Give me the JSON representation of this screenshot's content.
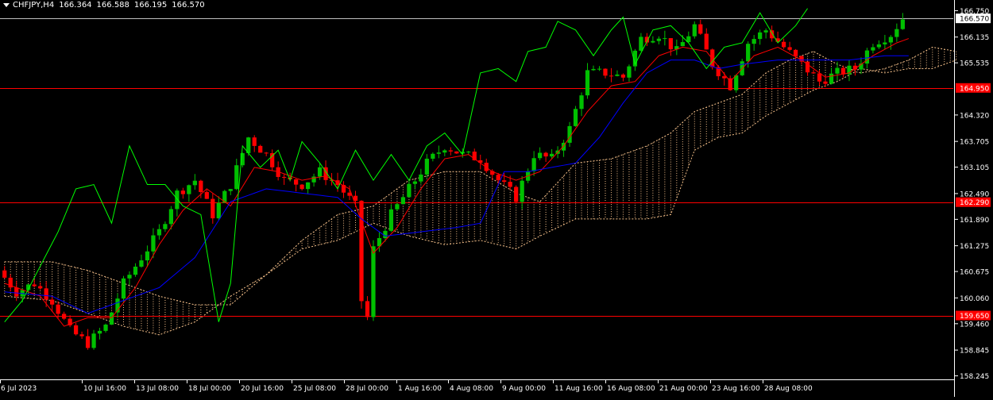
{
  "chart_data": {
    "type": "candlestick",
    "symbol": "CHFJPY,H4",
    "ohlc_label": {
      "open": "166.364",
      "high": "166.588",
      "low": "166.195",
      "close": "166.570"
    },
    "y_ticks": [
      "166.750",
      "166.570",
      "166.135",
      "165.535",
      "164.950",
      "164.320",
      "163.705",
      "163.105",
      "162.490",
      "162.290",
      "161.890",
      "161.275",
      "160.675",
      "160.060",
      "159.650",
      "159.460",
      "158.845",
      "158.245"
    ],
    "x_labels": [
      "6 Jul 2023",
      "10 Jul 16:00",
      "13 Jul 08:00",
      "18 Jul 00:00",
      "20 Jul 16:00",
      "25 Jul 08:00",
      "28 Jul 00:00",
      "1 Aug 16:00",
      "4 Aug 08:00",
      "9 Aug 00:00",
      "11 Aug 16:00",
      "16 Aug 08:00",
      "21 Aug 00:00",
      "23 Aug 16:00",
      "28 Aug 08:00"
    ],
    "ylim": [
      158.2,
      166.85
    ],
    "price_levels": [
      {
        "value": 166.57,
        "label": "166.570",
        "kind": "current"
      },
      {
        "value": 164.95,
        "label": "164.950",
        "kind": "horizontal"
      },
      {
        "value": 162.29,
        "label": "162.290",
        "kind": "horizontal"
      },
      {
        "value": 159.65,
        "label": "159.650",
        "kind": "horizontal"
      }
    ],
    "close_path": [
      [
        0,
        160.7
      ],
      [
        3,
        160.2
      ],
      [
        6,
        160.4
      ],
      [
        9,
        160.0
      ],
      [
        12,
        159.3
      ],
      [
        15,
        159.0
      ],
      [
        18,
        159.4
      ],
      [
        21,
        160.4
      ],
      [
        24,
        161.0
      ],
      [
        27,
        161.6
      ],
      [
        30,
        162.5
      ],
      [
        33,
        162.8
      ],
      [
        36,
        162.0
      ],
      [
        39,
        162.7
      ],
      [
        42,
        163.8
      ],
      [
        45,
        163.4
      ],
      [
        48,
        162.8
      ],
      [
        51,
        162.7
      ],
      [
        54,
        163.0
      ],
      [
        57,
        162.7
      ],
      [
        60,
        162.2
      ],
      [
        61,
        160.0
      ],
      [
        62,
        159.6
      ],
      [
        63,
        161.2
      ],
      [
        66,
        162.0
      ],
      [
        69,
        162.6
      ],
      [
        72,
        163.2
      ],
      [
        75,
        163.6
      ],
      [
        78,
        163.4
      ],
      [
        81,
        163.3
      ],
      [
        84,
        162.8
      ],
      [
        87,
        162.4
      ],
      [
        90,
        163.4
      ],
      [
        93,
        163.3
      ],
      [
        96,
        164.0
      ],
      [
        99,
        165.3
      ],
      [
        102,
        165.3
      ],
      [
        105,
        165.2
      ],
      [
        108,
        166.1
      ],
      [
        111,
        166.2
      ],
      [
        114,
        165.8
      ],
      [
        117,
        166.4
      ],
      [
        120,
        165.5
      ],
      [
        123,
        165.0
      ],
      [
        126,
        166.0
      ],
      [
        129,
        166.3
      ],
      [
        132,
        165.9
      ],
      [
        135,
        165.5
      ],
      [
        138,
        165.1
      ],
      [
        141,
        165.3
      ],
      [
        144,
        165.4
      ],
      [
        147,
        166.0
      ],
      [
        150,
        166.2
      ],
      [
        152,
        166.57
      ]
    ],
    "tenkan_path": [
      [
        0,
        160.4
      ],
      [
        6,
        160.1
      ],
      [
        10,
        159.4
      ],
      [
        14,
        159.6
      ],
      [
        18,
        159.6
      ],
      [
        22,
        160.3
      ],
      [
        26,
        161.3
      ],
      [
        30,
        162.1
      ],
      [
        34,
        162.6
      ],
      [
        38,
        162.2
      ],
      [
        42,
        163.1
      ],
      [
        46,
        163.0
      ],
      [
        50,
        162.8
      ],
      [
        54,
        162.9
      ],
      [
        58,
        162.6
      ],
      [
        62,
        161.1
      ],
      [
        66,
        161.7
      ],
      [
        70,
        162.6
      ],
      [
        74,
        163.3
      ],
      [
        78,
        163.4
      ],
      [
        82,
        163.0
      ],
      [
        86,
        162.8
      ],
      [
        90,
        163.0
      ],
      [
        94,
        163.6
      ],
      [
        98,
        164.4
      ],
      [
        102,
        165.0
      ],
      [
        106,
        165.1
      ],
      [
        110,
        165.7
      ],
      [
        114,
        165.9
      ],
      [
        118,
        165.8
      ],
      [
        122,
        165.1
      ],
      [
        126,
        165.7
      ],
      [
        130,
        165.9
      ],
      [
        134,
        165.6
      ],
      [
        138,
        165.2
      ],
      [
        142,
        165.3
      ],
      [
        146,
        165.7
      ],
      [
        150,
        166.0
      ],
      [
        152,
        166.1
      ]
    ],
    "kijun_path": [
      [
        0,
        160.2
      ],
      [
        8,
        160.1
      ],
      [
        14,
        159.7
      ],
      [
        20,
        160.0
      ],
      [
        26,
        160.3
      ],
      [
        32,
        161.0
      ],
      [
        38,
        162.3
      ],
      [
        44,
        162.6
      ],
      [
        50,
        162.5
      ],
      [
        56,
        162.4
      ],
      [
        60,
        161.9
      ],
      [
        64,
        161.5
      ],
      [
        70,
        161.6
      ],
      [
        76,
        161.7
      ],
      [
        80,
        161.8
      ],
      [
        84,
        163.0
      ],
      [
        88,
        163.0
      ],
      [
        92,
        163.1
      ],
      [
        96,
        163.2
      ],
      [
        100,
        163.8
      ],
      [
        104,
        164.6
      ],
      [
        108,
        165.3
      ],
      [
        112,
        165.6
      ],
      [
        116,
        165.6
      ],
      [
        120,
        165.4
      ],
      [
        124,
        165.5
      ],
      [
        130,
        165.6
      ],
      [
        136,
        165.6
      ],
      [
        142,
        165.6
      ],
      [
        148,
        165.7
      ],
      [
        152,
        165.7
      ]
    ],
    "chikou_path": [
      [
        0,
        159.5
      ],
      [
        3,
        160.0
      ],
      [
        6,
        160.8
      ],
      [
        9,
        161.6
      ],
      [
        12,
        162.6
      ],
      [
        15,
        162.7
      ],
      [
        18,
        161.8
      ],
      [
        21,
        163.6
      ],
      [
        24,
        162.7
      ],
      [
        27,
        162.7
      ],
      [
        30,
        162.2
      ],
      [
        33,
        162.0
      ],
      [
        36,
        159.5
      ],
      [
        38,
        160.4
      ],
      [
        40,
        163.6
      ],
      [
        43,
        163.1
      ],
      [
        46,
        163.5
      ],
      [
        48,
        162.8
      ],
      [
        50,
        163.7
      ],
      [
        53,
        163.2
      ],
      [
        56,
        162.6
      ],
      [
        59,
        163.5
      ],
      [
        62,
        162.8
      ],
      [
        65,
        163.4
      ],
      [
        68,
        162.8
      ],
      [
        71,
        163.6
      ],
      [
        74,
        163.9
      ],
      [
        77,
        163.4
      ],
      [
        80,
        165.3
      ],
      [
        83,
        165.4
      ],
      [
        86,
        165.1
      ],
      [
        88,
        165.8
      ],
      [
        91,
        165.9
      ],
      [
        93,
        166.5
      ],
      [
        96,
        166.3
      ],
      [
        99,
        165.7
      ],
      [
        102,
        166.3
      ],
      [
        104,
        166.6
      ],
      [
        106,
        165.5
      ],
      [
        109,
        166.3
      ],
      [
        112,
        166.4
      ],
      [
        115,
        166.0
      ],
      [
        118,
        165.4
      ],
      [
        121,
        165.9
      ],
      [
        124,
        166.0
      ],
      [
        127,
        166.7
      ],
      [
        130,
        166.0
      ],
      [
        133,
        166.4
      ],
      [
        135,
        166.8
      ]
    ],
    "kumo_top": [
      [
        0,
        160.9
      ],
      [
        8,
        160.9
      ],
      [
        14,
        160.7
      ],
      [
        20,
        160.4
      ],
      [
        26,
        160.1
      ],
      [
        32,
        159.9
      ],
      [
        38,
        159.9
      ],
      [
        44,
        160.6
      ],
      [
        50,
        161.4
      ],
      [
        56,
        162.0
      ],
      [
        62,
        162.2
      ],
      [
        68,
        162.8
      ],
      [
        74,
        163.0
      ],
      [
        80,
        163.0
      ],
      [
        86,
        162.5
      ],
      [
        90,
        162.3
      ],
      [
        96,
        163.2
      ],
      [
        102,
        163.3
      ],
      [
        108,
        163.6
      ],
      [
        112,
        163.9
      ],
      [
        116,
        164.4
      ],
      [
        120,
        164.6
      ],
      [
        124,
        164.8
      ],
      [
        128,
        165.3
      ],
      [
        132,
        165.6
      ],
      [
        136,
        165.8
      ],
      [
        140,
        165.5
      ],
      [
        144,
        165.3
      ],
      [
        148,
        165.4
      ],
      [
        152,
        165.6
      ],
      [
        156,
        165.9
      ],
      [
        160,
        165.8
      ]
    ],
    "kumo_bottom": [
      [
        0,
        160.1
      ],
      [
        8,
        160.0
      ],
      [
        14,
        159.7
      ],
      [
        20,
        159.4
      ],
      [
        26,
        159.2
      ],
      [
        32,
        159.5
      ],
      [
        38,
        160.1
      ],
      [
        44,
        160.6
      ],
      [
        50,
        161.2
      ],
      [
        56,
        161.4
      ],
      [
        62,
        161.8
      ],
      [
        68,
        161.5
      ],
      [
        74,
        161.3
      ],
      [
        80,
        161.4
      ],
      [
        86,
        161.2
      ],
      [
        90,
        161.5
      ],
      [
        96,
        161.9
      ],
      [
        102,
        161.9
      ],
      [
        108,
        161.9
      ],
      [
        112,
        162.0
      ],
      [
        116,
        163.5
      ],
      [
        120,
        163.8
      ],
      [
        124,
        163.9
      ],
      [
        128,
        164.3
      ],
      [
        132,
        164.6
      ],
      [
        136,
        164.9
      ],
      [
        140,
        165.1
      ],
      [
        144,
        165.4
      ],
      [
        148,
        165.3
      ],
      [
        152,
        165.4
      ],
      [
        156,
        165.4
      ],
      [
        160,
        165.6
      ]
    ],
    "n_bars": 152,
    "future_bars": 8,
    "colors": {
      "background": "#000000",
      "bull": "#00c000",
      "bear": "#ff0000",
      "tenkan": "#ff0000",
      "kijun": "#0000ff",
      "chikou": "#00ff00",
      "kumo": "#f5c08a",
      "hline": "#ff0000",
      "current_line": "#c0c0c0",
      "axis_text": "#ffffff",
      "label_bg": "#ff0000"
    }
  }
}
